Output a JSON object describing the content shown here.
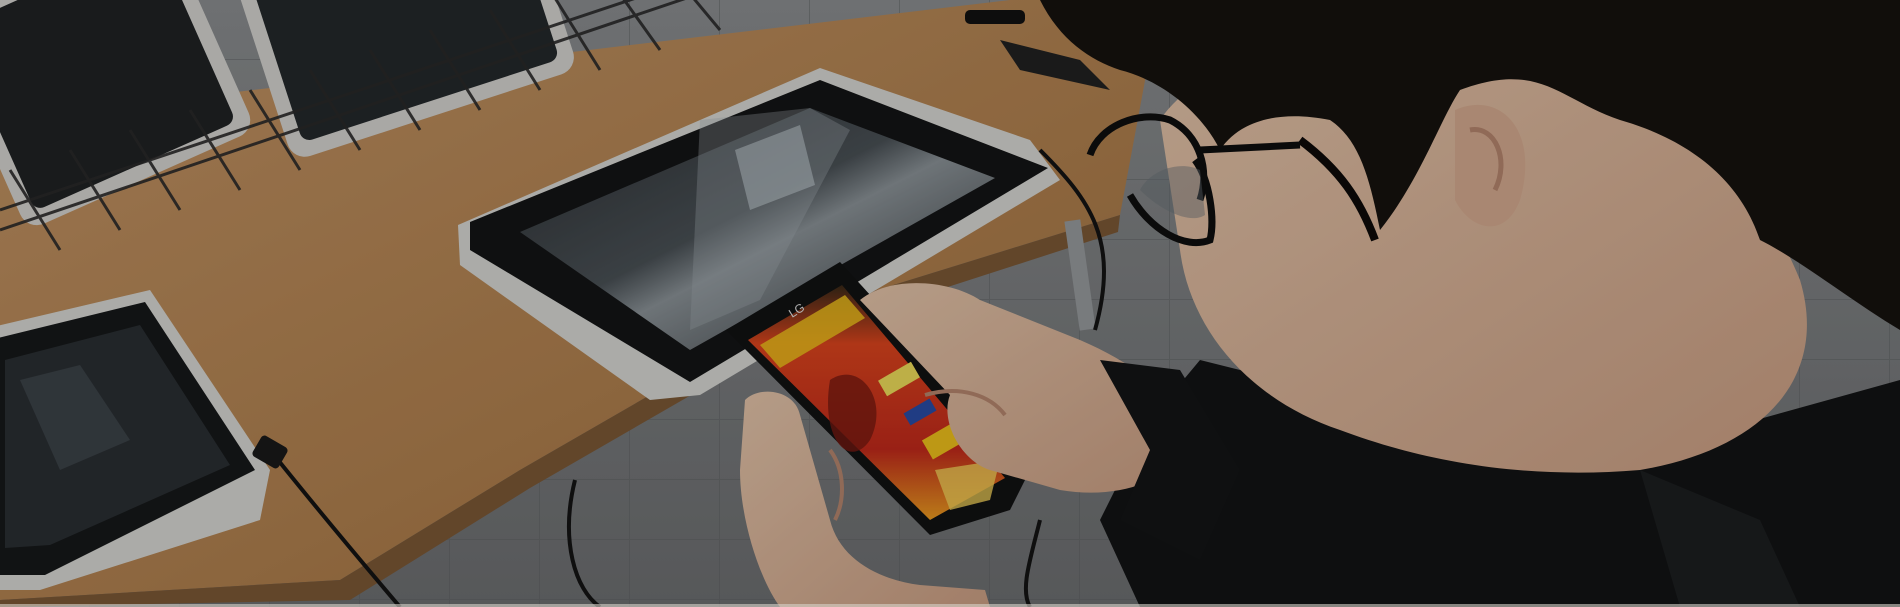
{
  "hero": {
    "image_description_name": "person-playing-smartphone-game",
    "phone_brand": "LG",
    "colors": {
      "floor": "#8a8c8e",
      "table": "#b98a55",
      "tablet_frame": "#1a1b1c",
      "tablet_bezel": "#d9d8d4",
      "hair": "#1a1512",
      "skin": "#e2c0a4",
      "shirt": "#121314",
      "game_red": "#d8341e",
      "game_yellow": "#f2c31c",
      "overlay": "rgba(0,0,0,0.22)"
    }
  }
}
